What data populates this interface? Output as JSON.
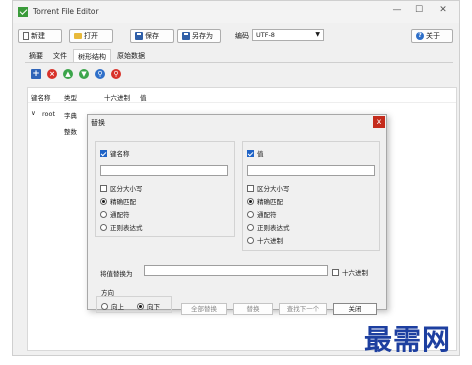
{
  "window": {
    "title": "Torrent File Editor",
    "minimize": "—",
    "maximize": "☐",
    "close": "✕"
  },
  "toolbar": {
    "new": "新建",
    "open": "打开",
    "save": "保存",
    "save_as": "另存为",
    "encoding_label": "编码",
    "encoding_value": "UTF-8",
    "about": "关于"
  },
  "tabs": [
    "摘要",
    "文件",
    "树形结构",
    "原始数据"
  ],
  "tree": {
    "headers": {
      "name": "键名称",
      "type": "类型",
      "hex": "十六进制",
      "value": "值"
    },
    "rows": [
      {
        "name": "root",
        "type": "字典"
      },
      {
        "type": "整数"
      }
    ]
  },
  "dialog": {
    "title": "替换",
    "close": "x",
    "key_group": {
      "label": "键名称",
      "checked": true,
      "options": {
        "case": "区分大小写",
        "exact": "精确匹配",
        "wildcard": "通配符",
        "regex": "正则表达式"
      }
    },
    "value_group": {
      "label": "值",
      "checked": true,
      "options": {
        "case": "区分大小写",
        "exact": "精确匹配",
        "wildcard": "通配符",
        "regex": "正则表达式",
        "hex": "十六进制"
      }
    },
    "replace_label": "将值替换为",
    "hex_checkbox": "十六进制",
    "direction": {
      "label": "方向",
      "up": "向上",
      "down": "向下"
    },
    "buttons": {
      "replace_all": "全部替换",
      "replace": "替换",
      "find_next": "查找下一个",
      "close": "关闭"
    }
  },
  "watermark": "最需网"
}
